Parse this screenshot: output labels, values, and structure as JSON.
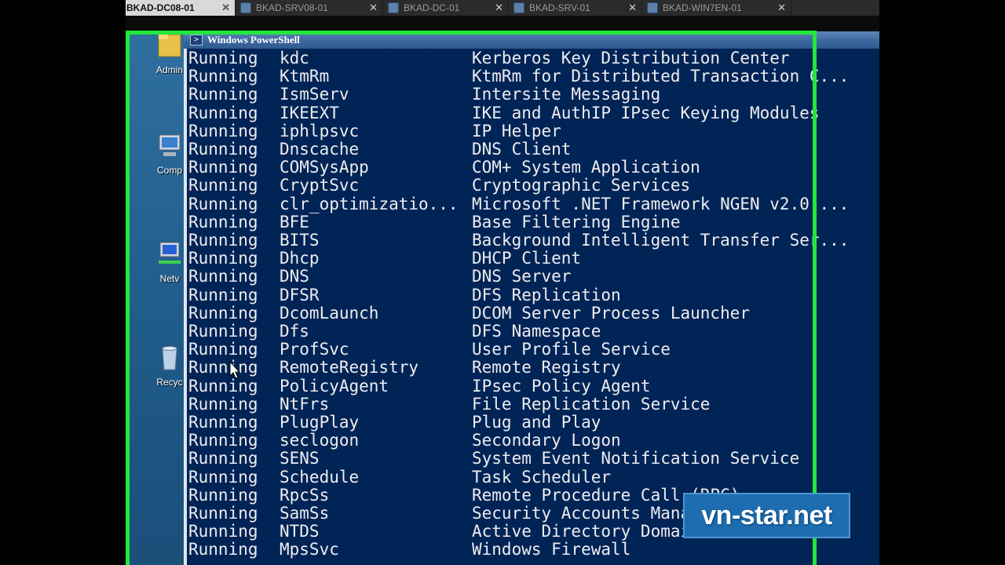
{
  "tabs": [
    {
      "label": "BKAD-DC08-01",
      "active": true
    },
    {
      "label": "BKAD-SRV08-01",
      "active": false
    },
    {
      "label": "BKAD-DC-01",
      "active": false
    },
    {
      "label": "BKAD-SRV-01",
      "active": false
    },
    {
      "label": "BKAD-WIN7EN-01",
      "active": false
    }
  ],
  "tab_close_glyph": "✕",
  "desktop_icons": [
    {
      "label": "Admin",
      "icon": "folder-icon"
    },
    {
      "label": "Comp",
      "icon": "computer-icon"
    },
    {
      "label": "Netv",
      "icon": "network-icon"
    },
    {
      "label": "Recyc",
      "icon": "recycle-bin-icon"
    }
  ],
  "console": {
    "title": "Windows PowerShell",
    "rows": [
      {
        "status": "Running",
        "name": "kdc",
        "display": "Kerberos Key Distribution Center"
      },
      {
        "status": "Running",
        "name": "KtmRm",
        "display": "KtmRm for Distributed Transaction C..."
      },
      {
        "status": "Running",
        "name": "IsmServ",
        "display": "Intersite Messaging"
      },
      {
        "status": "Running",
        "name": "IKEEXT",
        "display": "IKE and AuthIP IPsec Keying Modules"
      },
      {
        "status": "Running",
        "name": "iphlpsvc",
        "display": "IP Helper"
      },
      {
        "status": "Running",
        "name": "Dnscache",
        "display": "DNS Client"
      },
      {
        "status": "Running",
        "name": "COMSysApp",
        "display": "COM+ System Application"
      },
      {
        "status": "Running",
        "name": "CryptSvc",
        "display": "Cryptographic Services"
      },
      {
        "status": "Running",
        "name": "clr_optimizatio...",
        "display": "Microsoft .NET Framework NGEN v2.0...."
      },
      {
        "status": "Running",
        "name": "BFE",
        "display": "Base Filtering Engine"
      },
      {
        "status": "Running",
        "name": "BITS",
        "display": "Background Intelligent Transfer Ser..."
      },
      {
        "status": "Running",
        "name": "Dhcp",
        "display": "DHCP Client"
      },
      {
        "status": "Running",
        "name": "DNS",
        "display": "DNS Server"
      },
      {
        "status": "Running",
        "name": "DFSR",
        "display": "DFS Replication"
      },
      {
        "status": "Running",
        "name": "DcomLaunch",
        "display": "DCOM Server Process Launcher"
      },
      {
        "status": "Running",
        "name": "Dfs",
        "display": "DFS Namespace"
      },
      {
        "status": "Running",
        "name": "ProfSvc",
        "display": "User Profile Service"
      },
      {
        "status": "Running",
        "name": "RemoteRegistry",
        "display": "Remote Registry"
      },
      {
        "status": "Running",
        "name": "PolicyAgent",
        "display": "IPsec Policy Agent"
      },
      {
        "status": "Running",
        "name": "NtFrs",
        "display": "File Replication Service"
      },
      {
        "status": "Running",
        "name": "PlugPlay",
        "display": "Plug and Play"
      },
      {
        "status": "Running",
        "name": "seclogon",
        "display": "Secondary Logon"
      },
      {
        "status": "Running",
        "name": "SENS",
        "display": "System Event Notification Service"
      },
      {
        "status": "Running",
        "name": "Schedule",
        "display": "Task Scheduler"
      },
      {
        "status": "Running",
        "name": "RpcSs",
        "display": "Remote Procedure Call (RPC)"
      },
      {
        "status": "Running",
        "name": "SamSs",
        "display": "Security Accounts Manager"
      },
      {
        "status": "Running",
        "name": "NTDS",
        "display": "Active Directory Domain Services"
      },
      {
        "status": "Running",
        "name": "MpsSvc",
        "display": "Windows Firewall"
      }
    ]
  },
  "watermark": "vn-star.net",
  "colors": {
    "console_bg": "#012456",
    "console_text": "#eeedf0",
    "highlight_frame": "#22e83a",
    "watermark_bg": "#1d6db0"
  }
}
